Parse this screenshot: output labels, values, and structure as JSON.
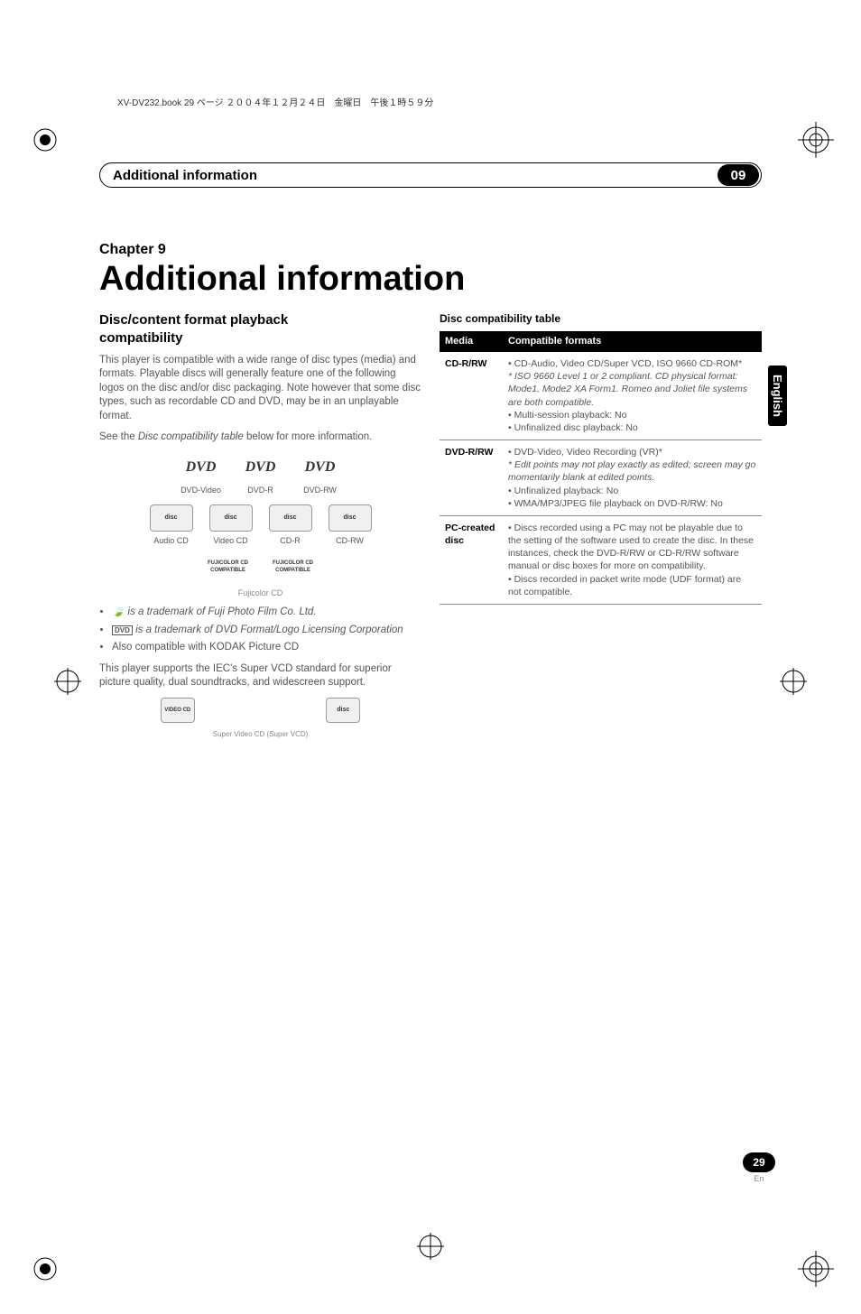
{
  "header_line": "XV-DV232.book  29 ページ  ２００４年１２月２４日　金曜日　午後１時５９分",
  "section": {
    "title": "Additional information",
    "num": "09"
  },
  "side_tab": "English",
  "chapter": {
    "label": "Chapter 9",
    "title": "Additional information"
  },
  "left": {
    "h2a": "Disc/content format playback",
    "h2b": "compatibility",
    "p1": "This player is compatible with a wide range of disc types (media) and formats. Playable discs will generally feature one of the following logos on the disc and/or disc packaging. Note however that some disc types, such as recordable CD and DVD, may be in an unplayable format.",
    "p2a": "See the ",
    "p2i": "Disc compatibility table",
    "p2b": " below for more information.",
    "logos_row1": [
      {
        "name": "dvd-video-logo",
        "text": "DVD",
        "caption": "DVD-Video"
      },
      {
        "name": "dvd-r-logo",
        "text": "DVD",
        "caption": "DVD-R"
      },
      {
        "name": "dvd-rw-logo",
        "text": "DVD",
        "caption": "DVD-RW"
      }
    ],
    "logos_row2": [
      {
        "name": "audio-cd-logo",
        "text": "disc",
        "caption": "Audio CD"
      },
      {
        "name": "video-cd-logo",
        "text": "disc",
        "caption": "Video CD"
      },
      {
        "name": "cd-r-logo",
        "text": "disc",
        "caption": "CD-R"
      },
      {
        "name": "cd-rw-logo",
        "text": "disc",
        "caption": "CD-RW"
      }
    ],
    "fuji_caption": "Fujicolor CD",
    "fuji_compat": "FUJICOLOR CD COMPATIBLE",
    "bul1": " is a trademark of Fuji Photo Film Co. Ltd.",
    "bul2": " is a trademark of DVD Format/Logo Licensing Corporation",
    "bul3": "Also compatible with KODAK Picture CD",
    "p3": "This player supports the IEC's Super VCD standard for superior picture quality, dual soundtracks, and widescreen support.",
    "svcd_caption": "Super Video CD (Super VCD)"
  },
  "right": {
    "h3": "Disc compatibility table",
    "th_media": "Media",
    "th_formats": "Compatible formats",
    "rows": [
      {
        "media": "CD-R/RW",
        "lines": [
          {
            "t": "• CD-Audio, Video CD/Super VCD, ISO 9660 CD-ROM*",
            "i": false
          },
          {
            "t": "* ISO 9660 Level 1 or 2 compliant. CD physical format: Mode1, Mode2 XA Form1. Romeo and Joliet file systems are both compatible.",
            "i": true
          },
          {
            "t": "• Multi-session playback: No",
            "i": false
          },
          {
            "t": "• Unfinalized disc playback: No",
            "i": false
          }
        ]
      },
      {
        "media": "DVD-R/RW",
        "lines": [
          {
            "t": "• DVD-Video, Video Recording (VR)*",
            "i": false
          },
          {
            "t": "* Edit points may not play exactly as edited; screen may go momentarily blank at edited points.",
            "i": true
          },
          {
            "t": "• Unfinalized playback: No",
            "i": false
          },
          {
            "t": "• WMA/MP3/JPEG file playback on DVD-R/RW: No",
            "i": false
          }
        ]
      },
      {
        "media": "PC-created disc",
        "lines": [
          {
            "t": "• Discs recorded using a PC may not be playable due to the setting of the software used to create the disc. In these instances, check the DVD-R/RW or CD-R/RW software manual or disc boxes for more on compatibility.",
            "i": false
          },
          {
            "t": "• Discs recorded in packet write mode (UDF format) are not compatible.",
            "i": false
          }
        ]
      }
    ]
  },
  "page": {
    "num": "29",
    "lang": "En"
  }
}
